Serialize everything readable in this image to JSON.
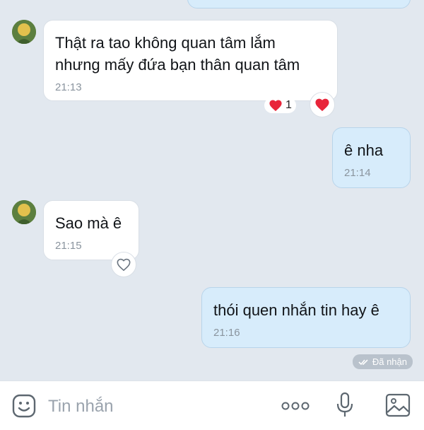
{
  "messages": [
    {
      "text": "Thật ra tao không quan tâm lắm\nnhưng mấy đứa bạn thân quan tâm",
      "time": "21:13"
    },
    {
      "text": "ê nha",
      "time": "21:14"
    },
    {
      "text": "Sao mà ê",
      "time": "21:15"
    },
    {
      "text": "thói quen nhắn tin hay ê",
      "time": "21:16"
    }
  ],
  "reaction": {
    "count": "1",
    "icon": "heart-icon"
  },
  "status_label": "Đã nhận",
  "composer": {
    "placeholder": "Tin nhắn"
  },
  "colors": {
    "incoming": "#ffffff",
    "outgoing": "#d7ecfb",
    "background": "#e2e8ef",
    "heart": "#e8253a"
  }
}
